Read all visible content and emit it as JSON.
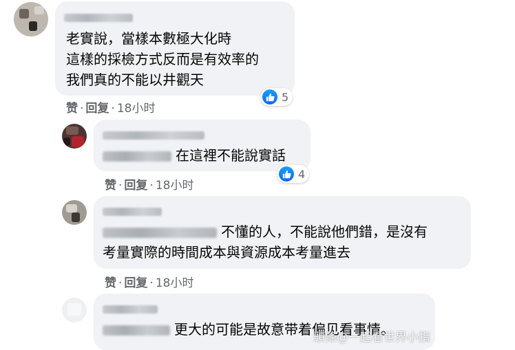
{
  "comments": [
    {
      "lines": [
        "老實說，當樣本數極大化時",
        "這樣的採檢方式反而是有效率的",
        "我們真的不能以井觀天"
      ],
      "actions": {
        "like": "赞",
        "reply": "回复",
        "time": "18小时"
      },
      "reactions": {
        "icon": "like-icon",
        "count": "5"
      }
    },
    {
      "text": "在這裡不能說實話",
      "actions": {
        "like": "赞",
        "reply": "回复",
        "time": "18小时"
      },
      "reactions": {
        "icon": "like-icon",
        "count": "4"
      }
    },
    {
      "lines": [
        "不懂的人，不能說他們錯，是沒有",
        "考量實際的時間成本與資源成本考量進去"
      ],
      "actions": {
        "like": "赞",
        "reply": "回复",
        "time": "18小时"
      }
    },
    {
      "text": "更大的可能是故意带着偏见看事情。"
    }
  ],
  "separator": "·",
  "watermark": "頭條@一起看世界小指",
  "colors": {
    "bubble": "#f0f2f5",
    "meta": "#65676b",
    "like_blue": "#0866ff"
  }
}
